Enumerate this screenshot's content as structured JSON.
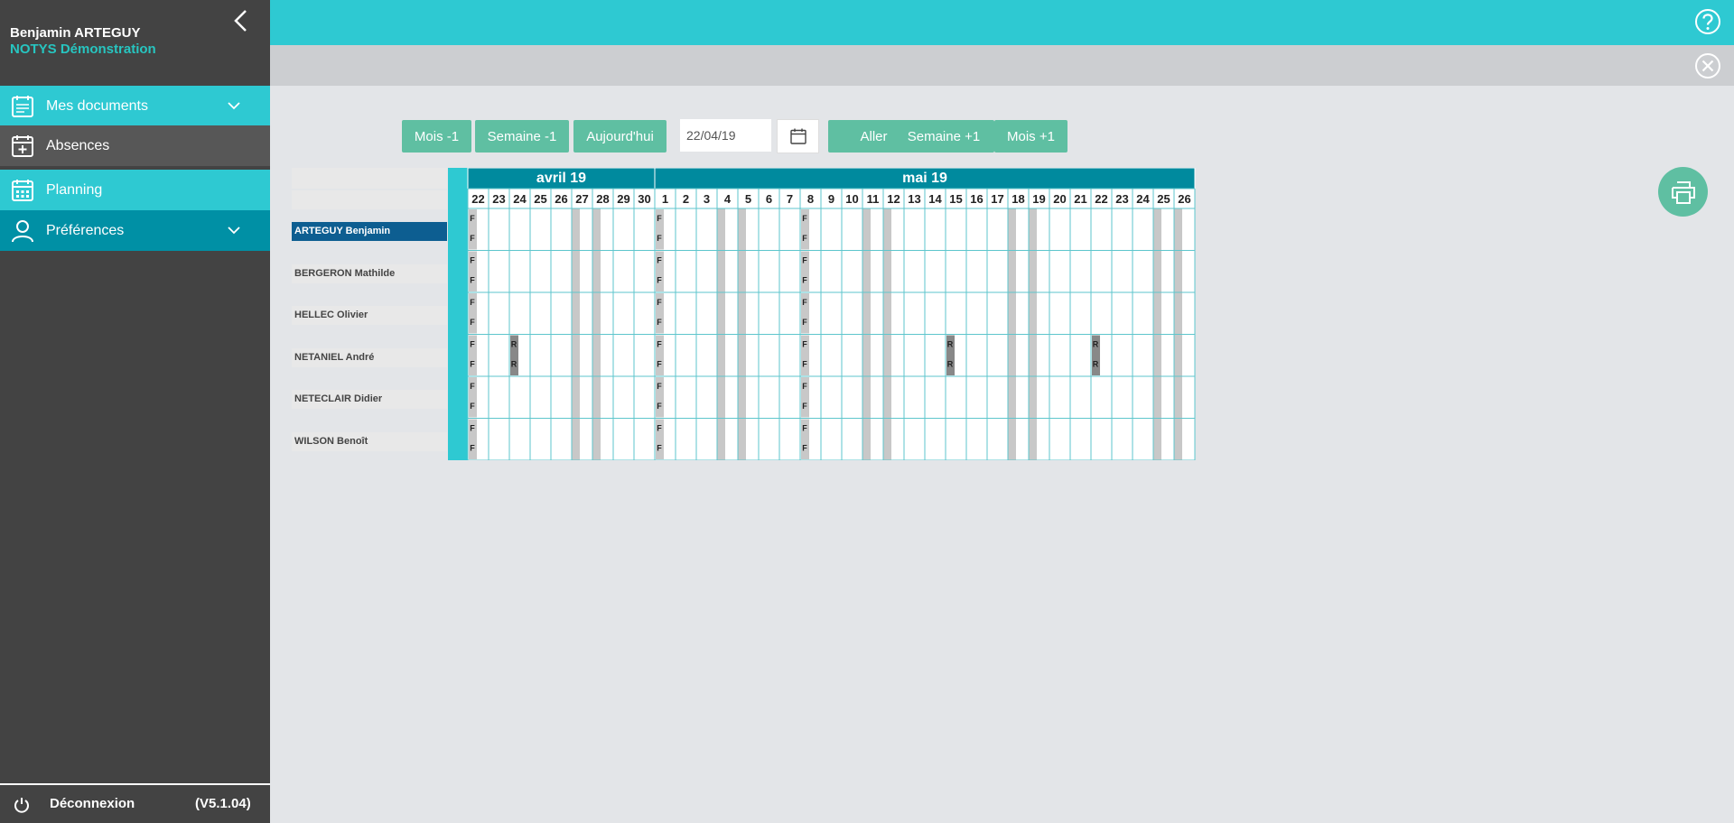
{
  "user": {
    "name": "Benjamin ARTEGUY",
    "org": "NOTYS Démonstration"
  },
  "nav": {
    "docs": "Mes documents",
    "absences": "Absences",
    "planning": "Planning",
    "prefs": "Préférences"
  },
  "footer": {
    "logout": "Déconnexion",
    "version": "(V5.1.04)"
  },
  "toolbar": {
    "mois_prev": "Mois -1",
    "semaine_prev": "Semaine -1",
    "today": "Aujourd'hui",
    "date_value": "22/04/19",
    "go": "Aller",
    "semaine_next": "Semaine +1",
    "mois_next": "Mois +1"
  },
  "planning": {
    "months": [
      {
        "label": "avril 19",
        "days": [
          22,
          23,
          24,
          25,
          26,
          27,
          28,
          29,
          30
        ]
      },
      {
        "label": "mai 19",
        "days": [
          1,
          2,
          3,
          4,
          5,
          6,
          7,
          8,
          9,
          10,
          11,
          12,
          13,
          14,
          15,
          16,
          17,
          18,
          19,
          20,
          21,
          22,
          23,
          24,
          25,
          26
        ]
      }
    ],
    "weekend_columns": [
      5,
      6,
      12,
      13,
      19,
      20,
      26,
      27,
      33,
      34
    ],
    "employees": [
      {
        "name": "ARTEGUY Benjamin",
        "selected": true,
        "marks": [
          {
            "col": 0,
            "code": "F"
          },
          {
            "col": 9,
            "code": "F"
          },
          {
            "col": 16,
            "code": "F"
          }
        ]
      },
      {
        "name": "BERGERON Mathilde",
        "selected": false,
        "marks": [
          {
            "col": 0,
            "code": "F"
          },
          {
            "col": 9,
            "code": "F"
          },
          {
            "col": 16,
            "code": "F"
          }
        ]
      },
      {
        "name": "HELLEC Olivier",
        "selected": false,
        "marks": [
          {
            "col": 0,
            "code": "F"
          },
          {
            "col": 9,
            "code": "F"
          },
          {
            "col": 16,
            "code": "F"
          }
        ]
      },
      {
        "name": "NETANIEL André",
        "selected": false,
        "marks": [
          {
            "col": 0,
            "code": "F"
          },
          {
            "col": 2,
            "code": "R"
          },
          {
            "col": 9,
            "code": "F"
          },
          {
            "col": 16,
            "code": "F"
          },
          {
            "col": 23,
            "code": "R"
          },
          {
            "col": 30,
            "code": "R"
          }
        ]
      },
      {
        "name": "NETECLAIR Didier",
        "selected": false,
        "marks": [
          {
            "col": 0,
            "code": "F"
          },
          {
            "col": 9,
            "code": "F"
          },
          {
            "col": 16,
            "code": "F"
          }
        ]
      },
      {
        "name": "WILSON Benoît",
        "selected": false,
        "marks": [
          {
            "col": 0,
            "code": "F"
          },
          {
            "col": 9,
            "code": "F"
          },
          {
            "col": 16,
            "code": "F"
          }
        ]
      }
    ]
  },
  "colors": {
    "accent": "#2ec9d2",
    "header_teal": "#008a9e",
    "button": "#5fbfa2",
    "sidebar": "#434343",
    "selected_row": "#0d5e91",
    "weekend": "#c8c8c8",
    "grid_line": "#5ec6cc"
  },
  "icons": {
    "collapse": "chevron-left-icon",
    "help": "help-circle-icon",
    "close": "close-circle-icon",
    "calendar": "calendar-icon",
    "print": "print-icon",
    "logout": "power-icon"
  }
}
